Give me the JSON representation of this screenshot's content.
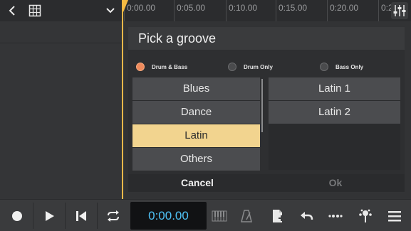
{
  "topbar": {
    "back_icon": "chevron-left-icon",
    "grid_icon": "grid-icon",
    "dropdown_icon": "chevron-down-icon",
    "mixer_icon": "mixer-sliders-icon",
    "ruler_ticks": [
      "0:00.00",
      "0:05.00",
      "0:10.00",
      "0:15.00",
      "0:20.00",
      "0:2"
    ]
  },
  "dialog": {
    "title": "Pick a groove",
    "radios": [
      {
        "label": "Drum & Bass",
        "selected": true
      },
      {
        "label": "Drum Only",
        "selected": false
      },
      {
        "label": "Bass Only",
        "selected": false
      }
    ],
    "categories": [
      {
        "label": "Blues",
        "selected": false
      },
      {
        "label": "Dance",
        "selected": false
      },
      {
        "label": "Latin",
        "selected": true
      },
      {
        "label": "Others",
        "selected": false
      }
    ],
    "grooves": [
      {
        "label": "Latin 1"
      },
      {
        "label": "Latin 2"
      }
    ],
    "cancel_label": "Cancel",
    "ok_label": "Ok"
  },
  "toolbar": {
    "time": "0:00.00",
    "icons": [
      "record-icon",
      "play-icon",
      "skip-to-start-icon",
      "loop-icon",
      "piano-keys-icon",
      "metronome-icon",
      "add-track-icon",
      "undo-icon",
      "more-dots-icon",
      "effects-icon",
      "menu-icon"
    ]
  },
  "colors": {
    "accent": "#f4b942",
    "selected_item": "#f2d48f",
    "radio_on": "#ef8a5c",
    "time_text": "#4fc3f7"
  }
}
